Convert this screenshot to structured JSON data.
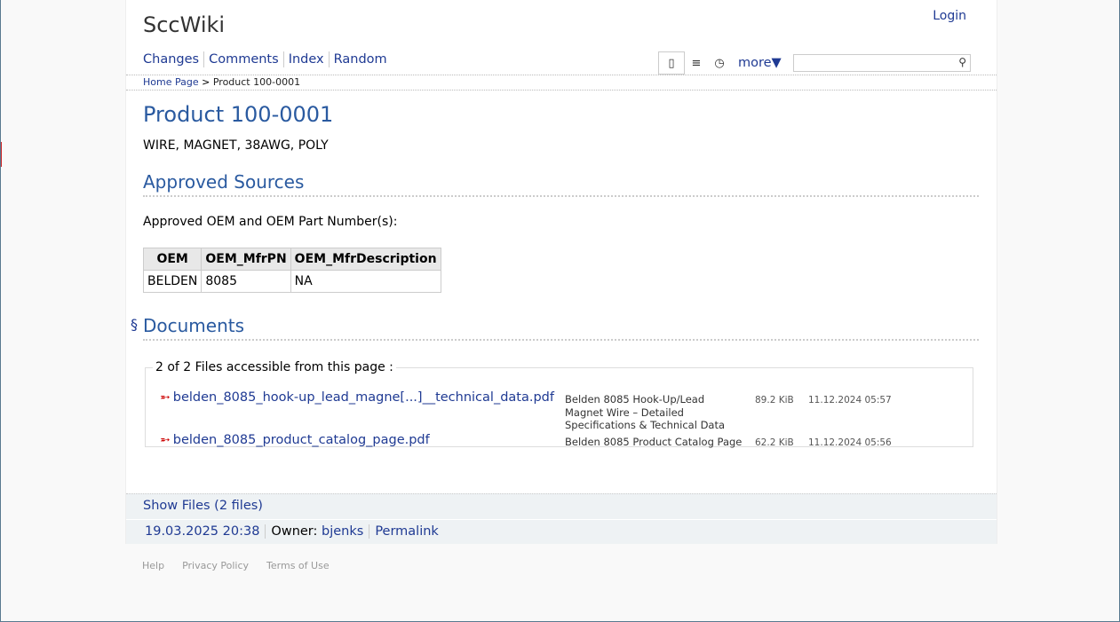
{
  "site": {
    "logo": "SccWiki",
    "login": "Login"
  },
  "nav": [
    "Changes",
    "Comments",
    "Index",
    "Random"
  ],
  "view": {
    "more": "more▼",
    "search_placeholder": ""
  },
  "breadcrumb": {
    "home": "Home Page",
    "separator": ">",
    "current": "Product 100-0001"
  },
  "page": {
    "title": "Product 100-0001",
    "description": "WIRE, MAGNET, 38AWG, POLY",
    "sources_heading": "Approved Sources",
    "approved_label": "Approved OEM and OEM Part Number(s):",
    "table": {
      "headers": [
        "OEM",
        "OEM_MfrPN",
        "OEM_MfrDescription"
      ],
      "rows": [
        [
          "BELDEN",
          "8085",
          "NA"
        ]
      ]
    },
    "documents_heading": "Documents",
    "section_mark": "§"
  },
  "files": {
    "legend": "2 of 2 Files accessible from this page :",
    "items": [
      {
        "name": "belden_8085_hook-up_lead_magne[...]__technical_data.pdf",
        "description": "Belden 8085 Hook-Up/Lead Magnet Wire – Detailed Specifications & Technical Data",
        "size": "89.2 KiB",
        "date": "11.12.2024 05:57"
      },
      {
        "name": "belden_8085_product_catalog_page.pdf",
        "description": "Belden 8085 Product Catalog Page",
        "size": "62.2 KiB",
        "date": "11.12.2024 05:56"
      }
    ]
  },
  "footer": {
    "show_files": "Show Files (2 files)",
    "timestamp": "19.03.2025 20:38",
    "owner_label": "Owner:",
    "owner": "bjenks",
    "permalink": "Permalink"
  },
  "bottom_links": [
    "Help",
    "Privacy Policy",
    "Terms of Use"
  ],
  "colors": {
    "link": "#1f3a93",
    "heading": "#2a5aa0",
    "pdf_icon": "#cc0000"
  }
}
